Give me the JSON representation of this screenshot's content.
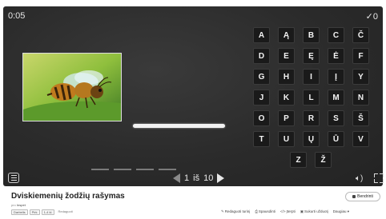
{
  "game": {
    "timer": "0:05",
    "score": "0",
    "check_icon": "check-icon",
    "letters": [
      "A",
      "Ą",
      "B",
      "C",
      "Č",
      "D",
      "E",
      "Ę",
      "Ė",
      "F",
      "G",
      "H",
      "I",
      "Į",
      "Y",
      "J",
      "K",
      "L",
      "M",
      "N",
      "O",
      "P",
      "R",
      "S",
      "Š",
      "T",
      "U",
      "Ų",
      "Ū",
      "V",
      "Z",
      "Ž"
    ],
    "pager": {
      "current": "1",
      "separator": "iš",
      "total": "10"
    },
    "progress_slots": 4
  },
  "activity": {
    "title": "Dviskiemenių žodžių rašymas",
    "author_prefix": "pro",
    "author": "Inspet",
    "tags": [
      "Darbelis",
      "Pirk",
      "1-4 kl."
    ],
    "tag_extra": "Redaguoti",
    "share_label": "Bendrinti",
    "actions": [
      "Redaguoti turinį",
      "Spausdinti",
      "Įterpti",
      "Sukurti užduotį",
      "Daugiau"
    ]
  },
  "colors": {
    "board": "#2b2b2b",
    "key_bg": "#1a1a1a",
    "text_light": "#f3f3f3"
  }
}
